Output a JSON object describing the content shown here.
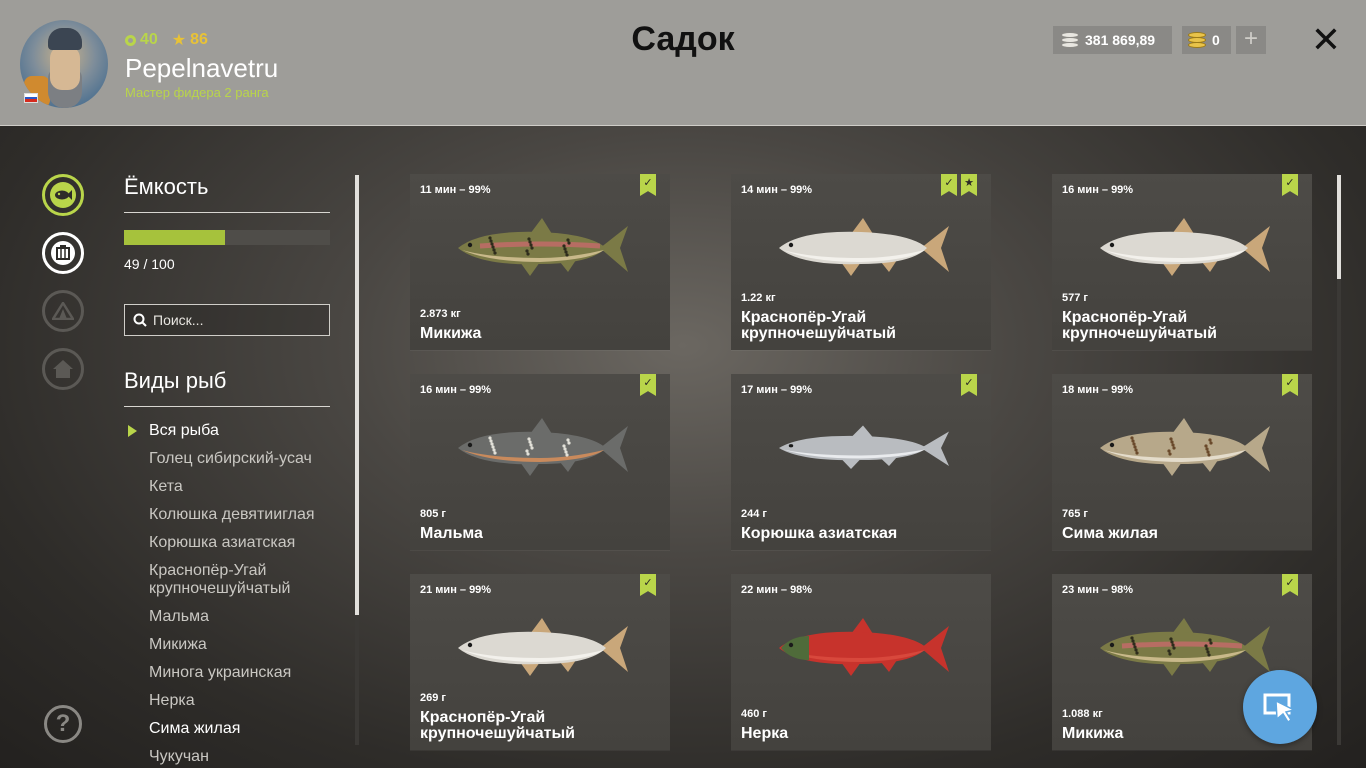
{
  "header": {
    "title": "Садок",
    "player": {
      "name": "Pepelnavetru",
      "rank": "Мастер фидера 2 ранга",
      "experience": "40",
      "level": "86"
    },
    "silver": "381 869,89",
    "gold": "0",
    "add_icon": "plus-icon",
    "close_icon": "close-icon"
  },
  "capacity": {
    "title": "Ёмкость",
    "current": 49,
    "max": 100,
    "label": "49 / 100",
    "fill_color": "#a6c23c"
  },
  "search": {
    "placeholder": "Поиск..."
  },
  "species": {
    "title": "Виды рыб",
    "items": [
      "Вся рыба",
      "Голец сибирский-усач",
      "Кета",
      "Колюшка девятииглая",
      "Корюшка азиатская",
      "Краснопёр-Угай крупночешуйчатый",
      "Мальма",
      "Микижа",
      "Минога украинская",
      "Нерка",
      "Сима жилая",
      "Чукучан"
    ],
    "selected": "Вся рыба"
  },
  "catches": [
    {
      "time": "11 мин – 99%",
      "weight": "2.873 кг",
      "name": "Микижа",
      "badges": [
        "check"
      ]
    },
    {
      "time": "14 мин – 99%",
      "weight": "1.22 кг",
      "name": "Краснопёр-Угай крупночешуйчатый",
      "badges": [
        "check",
        "star"
      ]
    },
    {
      "time": "16 мин – 99%",
      "weight": "577 г",
      "name": "Краснопёр-Угай крупночешуйчатый",
      "badges": [
        "check"
      ]
    },
    {
      "time": "16 мин – 99%",
      "weight": "805 г",
      "name": "Мальма",
      "badges": [
        "check"
      ]
    },
    {
      "time": "17 мин – 99%",
      "weight": "244 г",
      "name": "Корюшка азиатская",
      "badges": [
        "check"
      ]
    },
    {
      "time": "18 мин – 99%",
      "weight": "765 г",
      "name": "Сима жилая",
      "badges": [
        "check"
      ]
    },
    {
      "time": "21 мин – 99%",
      "weight": "269 г",
      "name": "Краснопёр-Угай крупночешуйчатый",
      "badges": [
        "check"
      ]
    },
    {
      "time": "22 мин – 98%",
      "weight": "460 г",
      "name": "Нерка",
      "badges": []
    },
    {
      "time": "23 мин – 98%",
      "weight": "1.088 кг",
      "name": "Микижа",
      "badges": [
        "check"
      ]
    }
  ],
  "colors": {
    "accent": "#b9d54a",
    "level": "#e8c236",
    "cursor_button": "#5ea6e0"
  }
}
